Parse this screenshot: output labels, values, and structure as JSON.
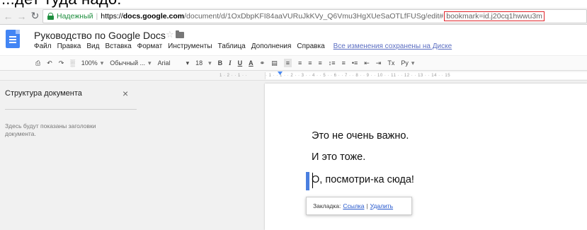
{
  "caption_text": "...дет туда надо:",
  "browser": {
    "back_icon": "arrow-left-icon",
    "forward_icon": "arrow-right-icon",
    "reload_icon": "reload-icon",
    "secure_label": "Надежный",
    "url_scheme": "https://",
    "url_host": "docs.google.com",
    "url_path": "/document/d/1OxDbpKFI84aaVURuJkKVy_Q6Vmu3HgXUeSaOTLfFUSg/edit#",
    "url_fragment": "bookmark=id.j20cq1hwwu3m",
    "highlight_color": "#e0252b"
  },
  "docs": {
    "title": "Руководство по Google Docs",
    "menu": [
      "Файл",
      "Правка",
      "Вид",
      "Вставка",
      "Формат",
      "Инструменты",
      "Таблица",
      "Дополнения",
      "Справка"
    ],
    "saved_status": "Все изменения сохранены на Диске",
    "accent": "#4285f4"
  },
  "toolbar": {
    "zoom": "100%",
    "style": "Обычный ...",
    "font": "Arial",
    "size": "18",
    "bold": "B",
    "italic": "I",
    "underline": "U",
    "text_color": "A",
    "clear_format": "Tx",
    "input_tools": "Ру"
  },
  "ruler": {
    "left_ticks": "1 · 2 · · 1 · ·",
    "ticks": "· 1 · · 1 · · 2 · · 3 · · 4 · · 5 · · 6 · · 7 · · 8 · · 9 · · 10 · · 11 · · 12 · · 13 · · 14 · · 15"
  },
  "outline": {
    "title": "Структура документа",
    "close": "×",
    "hint": "Здесь будут показаны заголовки документа."
  },
  "document": {
    "paragraphs": [
      "Это не очень важно.",
      "И это тоже.",
      "О, посмотри-ка сюда!"
    ]
  },
  "bookmark_bubble": {
    "label": "Закладка:",
    "link": "Ссылка",
    "separator": "|",
    "remove": "Удалить"
  }
}
